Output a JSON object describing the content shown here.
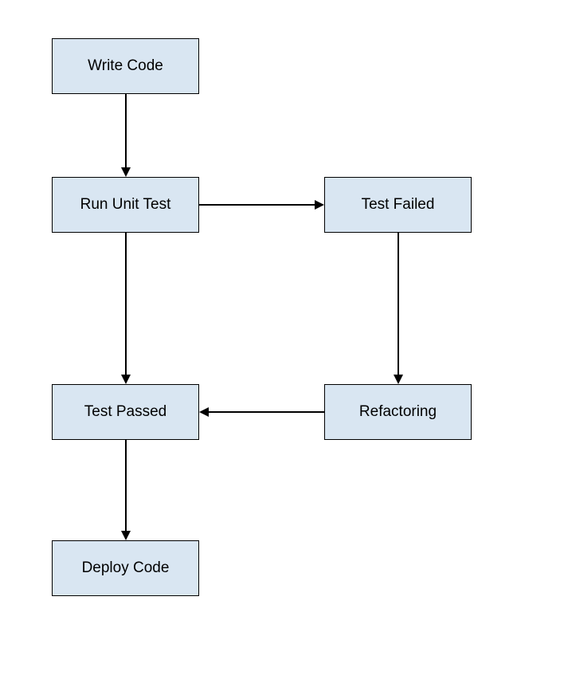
{
  "nodes": {
    "write_code": "Write Code",
    "run_unit_test": "Run Unit Test",
    "test_failed": "Test Failed",
    "test_passed": "Test Passed",
    "refactoring": "Refactoring",
    "deploy_code": "Deploy Code"
  },
  "diagram": {
    "type": "flowchart",
    "description": "Unit testing workflow",
    "edges": [
      {
        "from": "write_code",
        "to": "run_unit_test"
      },
      {
        "from": "run_unit_test",
        "to": "test_failed"
      },
      {
        "from": "run_unit_test",
        "to": "test_passed"
      },
      {
        "from": "test_failed",
        "to": "refactoring"
      },
      {
        "from": "refactoring",
        "to": "test_passed"
      },
      {
        "from": "test_passed",
        "to": "deploy_code"
      }
    ]
  }
}
